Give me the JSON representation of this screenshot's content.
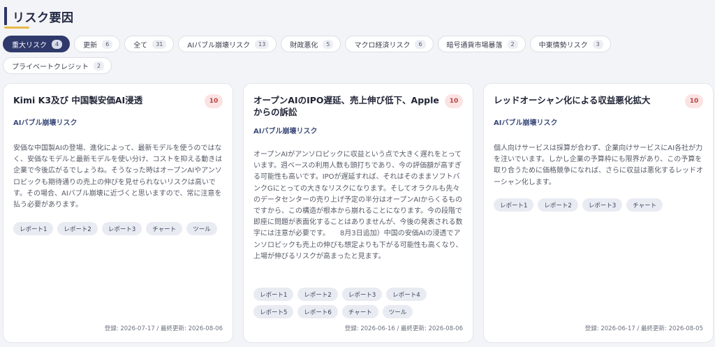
{
  "header": {
    "title": "リスク要因"
  },
  "filters": {
    "row1": [
      {
        "label": "重大リスク",
        "count": "4"
      },
      {
        "label": "更新",
        "count": "6"
      },
      {
        "label": "全て",
        "count": "31"
      },
      {
        "label": "AIバブル崩壊リスク",
        "count": "13"
      },
      {
        "label": "財政悪化",
        "count": "5"
      },
      {
        "label": "マクロ経済リスク",
        "count": "6"
      },
      {
        "label": "暗号通貨市場暴落",
        "count": "2"
      },
      {
        "label": "中東情勢リスク",
        "count": "3"
      }
    ],
    "row2": [
      {
        "label": "プライベートクレジット",
        "count": "2"
      }
    ]
  },
  "cards": [
    {
      "title": "Kimi K3及び 中国製安価AI浸透",
      "score": "10",
      "category": "AIバブル崩壊リスク",
      "body": "安価な中国製AIの登場、進化によって、最新モデルを使うのではなく、安価なモデルと最新モデルを使い分け、コストを抑える動きは企業で今後広がるでしょうね。そうなった時はオープンAIやアンソロピックも期待通りの売上の伸びを見せられないリスクは高いです。その場合、AIバブル崩壊に近づくと思いますので、常に注意を払う必要があります。",
      "tags": [
        "レポート1",
        "レポート2",
        "レポート3",
        "チャート",
        "ツール"
      ],
      "dates": "登録: 2026-07-17 / 最終更新: 2026-08-06"
    },
    {
      "title": "オープンAIのIPO遅延、売上伸び低下、Appleからの訴訟",
      "score": "10",
      "category": "AIバブル崩壊リスク",
      "body": "オープンAIがアンソロピックに収益という点で大きく遅れをとっています。週ベースの利用人数も頭打ちであり、今の評価額が高すぎる可能性も高いです。IPOが遅延すれば、それはそのままソフトバンクGにとっての大きなリスクになります。そしてオラクルも先々のデータセンターの売り上げ予定の半分はオープンAIからくるものですから、この構造が根本から崩れることになります。今の段階で即座に問題が表面化することはありませんが、今後の発表される数字には注意が必要です。　　8月3日追加）中国の安価AIの浸透でアンソロピックも売上の伸びも想定よりも下がる可能性も高くなり、上場が伸びるリスクが高まったと見ます。",
      "tags": [
        "レポート1",
        "レポート2",
        "レポート3",
        "レポート4",
        "レポート5",
        "レポート6",
        "チャート",
        "ツール"
      ],
      "dates": "登録: 2026-06-16 / 最終更新: 2026-08-06"
    },
    {
      "title": "レッドオーシャン化による収益悪化拡大",
      "score": "10",
      "category": "AIバブル崩壊リスク",
      "body": "個人向けサービスは採算が合わず、企業向けサービスにAI各社が力を注いでいます。しかし企業の予算枠にも限界があり、この予算を取り合うために価格競争になれば、さらに収益は悪化するレッドオーシャン化します。",
      "tags": [
        "レポート1",
        "レポート2",
        "レポート3",
        "チャート"
      ],
      "dates": "登録: 2026-06-17 / 最終更新: 2026-08-05"
    }
  ],
  "colors": {
    "accent": "#2f3a6b",
    "title_underline": "#e8b84a",
    "score_badge_bg": "#fbe3e3",
    "score_badge_text": "#b84242",
    "tag_bg": "#e9ebf3"
  }
}
